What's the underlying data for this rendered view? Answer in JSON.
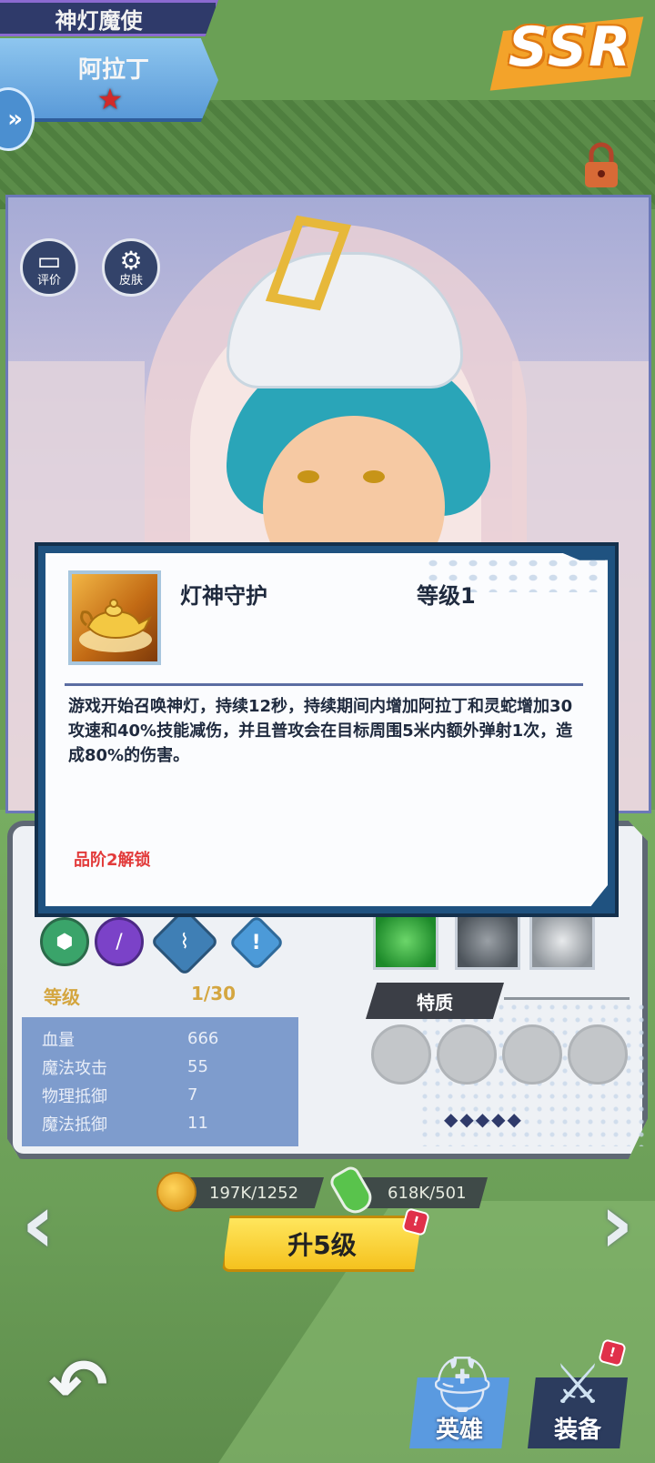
{
  "header": {
    "title": "神灯魔使",
    "hero_name": "阿拉丁",
    "rarity": "SSR"
  },
  "portrait": {
    "buttons": [
      {
        "label": "评价",
        "icon": "chat-icon"
      },
      {
        "label": "皮肤",
        "icon": "gear-icon"
      }
    ]
  },
  "skill_popup": {
    "name": "灯神守护",
    "level": "等级1",
    "description": "游戏开始召唤神灯，持续12秒，持续期间内增加阿拉丁和灵蛇增加30攻速和40%技能减伤，并且普攻会在目标周围5米内额外弹射1次，造成80%的伤害。",
    "unlock": "品阶2解锁"
  },
  "stats": {
    "level_label": "等级",
    "level_value": "1/30",
    "attributes": [
      {
        "key": "血量",
        "value": "666"
      },
      {
        "key": "魔法攻击",
        "value": "55"
      },
      {
        "key": "物理抵御",
        "value": "7"
      },
      {
        "key": "魔法抵御",
        "value": "11"
      }
    ],
    "special_label": "特质"
  },
  "resources": {
    "gold": "197K/1252",
    "potion": "618K/501"
  },
  "upgrade": {
    "label": "升5级"
  },
  "bottom_tabs": [
    {
      "label": "英雄",
      "icon": "helmet-icon"
    },
    {
      "label": "装备",
      "icon": "sword-icon"
    }
  ],
  "colors": {
    "popup_border": "#1f5280",
    "unlock_red": "#e23b3b",
    "upgrade_yellow": "#f5c21e",
    "background_green": "#6a9e57"
  }
}
